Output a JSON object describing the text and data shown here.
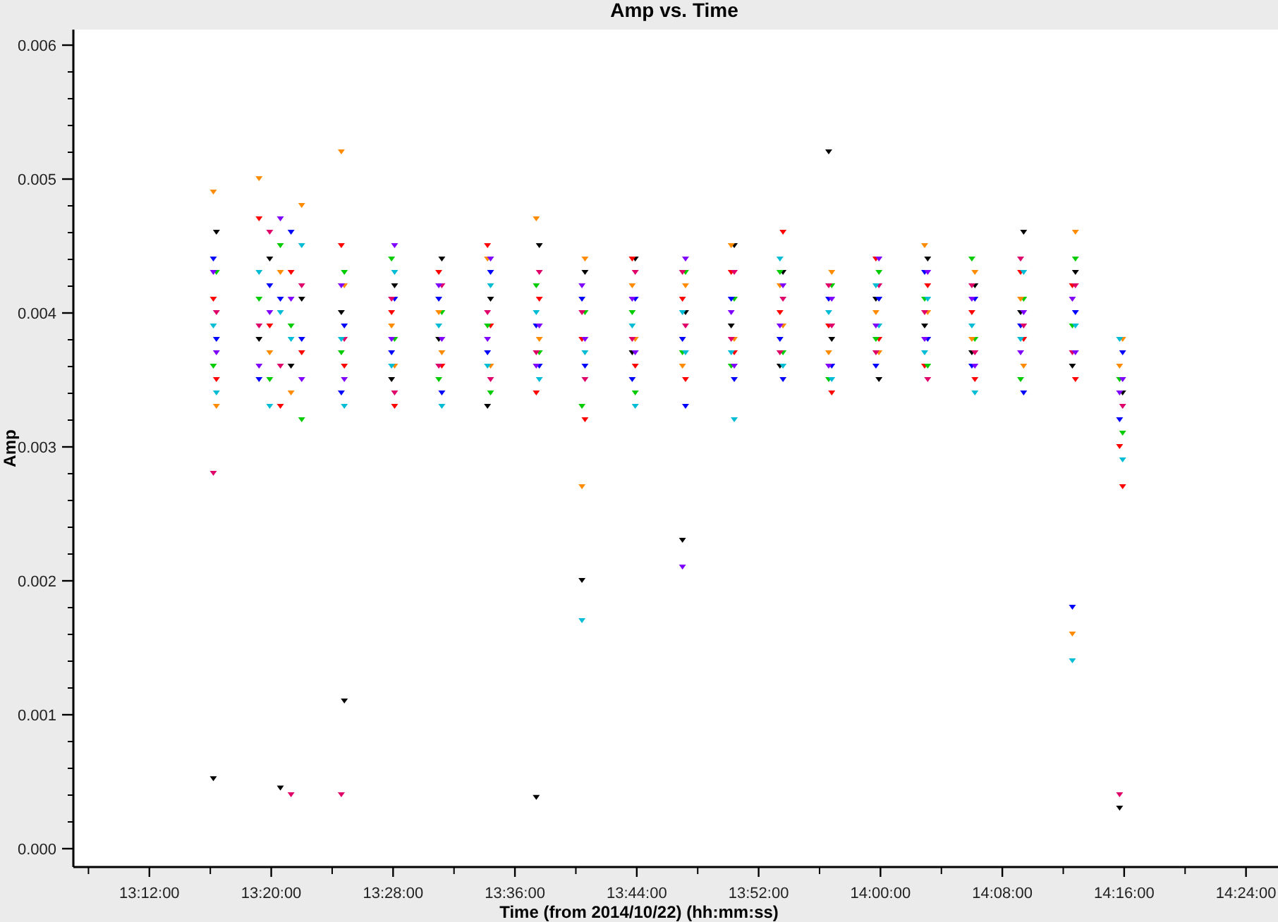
{
  "chart_data": {
    "type": "scatter",
    "title": "Amp vs. Time",
    "xlabel": "Time (from 2014/10/22) (hh:mm:ss)",
    "ylabel": "Amp",
    "xlim": [
      47226,
      51966
    ],
    "ylim": [
      -0.000137,
      0.006116
    ],
    "xticks": [
      {
        "value": 47520,
        "label": "13:12:00"
      },
      {
        "value": 48000,
        "label": "13:20:00"
      },
      {
        "value": 48480,
        "label": "13:28:00"
      },
      {
        "value": 48960,
        "label": "13:36:00"
      },
      {
        "value": 49440,
        "label": "13:44:00"
      },
      {
        "value": 49920,
        "label": "13:52:00"
      },
      {
        "value": 50400,
        "label": "14:00:00"
      },
      {
        "value": 50880,
        "label": "14:08:00"
      },
      {
        "value": 51360,
        "label": "14:16:00"
      },
      {
        "value": 51840,
        "label": "14:24:00"
      }
    ],
    "yticks": [
      {
        "value": 0,
        "label": "0.000"
      },
      {
        "value": 0.001,
        "label": "0.001"
      },
      {
        "value": 0.002,
        "label": "0.002"
      },
      {
        "value": 0.003,
        "label": "0.003"
      },
      {
        "value": 0.004,
        "label": "0.004"
      },
      {
        "value": 0.005,
        "label": "0.005"
      },
      {
        "value": 0.006,
        "label": "0.006"
      }
    ],
    "x": [
      47772,
      47784,
      47952,
      47994,
      48036,
      48078,
      48120,
      48276,
      48288,
      48474,
      48486,
      48660,
      48672,
      48852,
      48864,
      49044,
      49056,
      49224,
      49236,
      49422,
      49434,
      49620,
      49632,
      49812,
      49824,
      50004,
      50016,
      50196,
      50208,
      50382,
      50394,
      50574,
      50586,
      50760,
      50772,
      50952,
      50964,
      51156,
      51168,
      51342,
      51354
    ],
    "series": [
      {
        "color": "#000000",
        "values": [
          0.00052,
          0.0046,
          0.0038,
          0.0044,
          0.00045,
          0.0036,
          0.0041,
          0.004,
          0.0011,
          0.0035,
          0.0042,
          0.0038,
          0.0044,
          0.0033,
          0.0041,
          0.00038,
          0.0045,
          0.002,
          0.0043,
          0.0037,
          0.0044,
          0.0023,
          0.004,
          0.0039,
          0.0045,
          0.0036,
          0.0043,
          0.0052,
          0.0038,
          0.0041,
          0.0035,
          0.0039,
          0.0044,
          0.0037,
          0.0042,
          0.004,
          0.0046,
          0.0036,
          0.0043,
          0.0003,
          0.0034
        ]
      },
      {
        "color": "#ff0000",
        "values": [
          0.0041,
          0.0035,
          0.0047,
          0.0039,
          0.0033,
          0.0043,
          0.0037,
          0.0045,
          0.0036,
          0.004,
          0.0033,
          0.0043,
          0.0036,
          0.0045,
          0.0039,
          0.0034,
          0.0041,
          0.0038,
          0.0032,
          0.0044,
          0.0036,
          0.0041,
          0.0035,
          0.0043,
          0.0037,
          0.004,
          0.0046,
          0.0039,
          0.0034,
          0.0044,
          0.0038,
          0.0036,
          0.0042,
          0.004,
          0.0035,
          0.0043,
          0.0038,
          0.0042,
          0.0035,
          0.003,
          0.0027
        ]
      },
      {
        "color": "#00cc00",
        "values": [
          0.0036,
          0.0043,
          0.0041,
          0.0035,
          0.0045,
          0.0039,
          0.0032,
          0.0037,
          0.0043,
          0.0044,
          0.0038,
          0.0035,
          0.004,
          0.0039,
          0.0034,
          0.0042,
          0.0037,
          0.0033,
          0.004,
          0.004,
          0.0034,
          0.0037,
          0.0043,
          0.0036,
          0.0041,
          0.0043,
          0.0037,
          0.0035,
          0.0042,
          0.0038,
          0.0043,
          0.0041,
          0.0036,
          0.0044,
          0.0038,
          0.0035,
          0.0041,
          0.0039,
          0.0044,
          0.0035,
          0.0031
        ]
      },
      {
        "color": "#0000ff",
        "values": [
          0.0044,
          0.0038,
          0.0035,
          0.0042,
          0.0041,
          0.0046,
          0.0038,
          0.0034,
          0.0039,
          0.0037,
          0.0041,
          0.0041,
          0.0034,
          0.0037,
          0.0043,
          0.0039,
          0.0036,
          0.0041,
          0.0036,
          0.0035,
          0.0041,
          0.0038,
          0.0033,
          0.0041,
          0.0035,
          0.0038,
          0.0035,
          0.0041,
          0.0036,
          0.0036,
          0.0041,
          0.0043,
          0.0038,
          0.0036,
          0.0041,
          0.0039,
          0.0034,
          0.0018,
          0.004,
          0.0032,
          0.0037
        ]
      },
      {
        "color": "#ff8c00",
        "values": [
          0.0049,
          0.0033,
          0.005,
          0.0037,
          0.0043,
          0.0034,
          0.0048,
          0.0052,
          0.0042,
          0.0039,
          0.0036,
          0.004,
          0.0037,
          0.0044,
          0.0036,
          0.0047,
          0.0038,
          0.0027,
          0.0044,
          0.0042,
          0.0038,
          0.0036,
          0.0042,
          0.0045,
          0.0038,
          0.0042,
          0.0039,
          0.0037,
          0.0043,
          0.004,
          0.0037,
          0.0045,
          0.004,
          0.0038,
          0.0043,
          0.0041,
          0.0036,
          0.0016,
          0.0046,
          0.0036,
          0.0038
        ]
      },
      {
        "color": "#e0006a",
        "values": [
          0.0028,
          0.004,
          0.0039,
          0.0046,
          0.0036,
          0.0004,
          0.0042,
          0.0004,
          0.0038,
          0.0041,
          0.0034,
          0.0036,
          0.0042,
          0.004,
          0.0035,
          0.0037,
          0.0043,
          0.004,
          0.0035,
          0.0038,
          0.0043,
          0.0043,
          0.0039,
          0.0038,
          0.0043,
          0.0037,
          0.0041,
          0.0042,
          0.0039,
          0.0037,
          0.0042,
          0.004,
          0.0035,
          0.0042,
          0.0037,
          0.0044,
          0.0039,
          0.0037,
          0.0042,
          0.0004,
          0.0033
        ]
      },
      {
        "color": "#00bcd4",
        "values": [
          0.0039,
          0.0034,
          0.0043,
          0.0033,
          0.004,
          0.0038,
          0.0045,
          0.0038,
          0.0033,
          0.0036,
          0.0043,
          0.0039,
          0.0033,
          0.0036,
          0.0042,
          0.004,
          0.0035,
          0.0017,
          0.0037,
          0.0039,
          0.0033,
          0.004,
          0.0037,
          0.0037,
          0.0032,
          0.0044,
          0.0036,
          0.004,
          0.0035,
          0.0042,
          0.0039,
          0.0037,
          0.0041,
          0.0039,
          0.0034,
          0.0038,
          0.0043,
          0.0014,
          0.0039,
          0.0038,
          0.0029
        ]
      },
      {
        "color": "#8000ff",
        "values": [
          0.0043,
          0.0037,
          0.0036,
          0.004,
          0.0047,
          0.0041,
          0.0035,
          0.0042,
          0.0035,
          0.0038,
          0.0045,
          0.0042,
          0.0038,
          0.0038,
          0.0044,
          0.0036,
          0.0039,
          0.0042,
          0.0038,
          0.0041,
          0.0037,
          0.0021,
          0.0044,
          0.004,
          0.0036,
          0.0039,
          0.0042,
          0.0036,
          0.0041,
          0.0039,
          0.0044,
          0.0038,
          0.0043,
          0.0041,
          0.0036,
          0.0037,
          0.004,
          0.0041,
          0.0037,
          0.0034,
          0.0035
        ]
      }
    ]
  }
}
